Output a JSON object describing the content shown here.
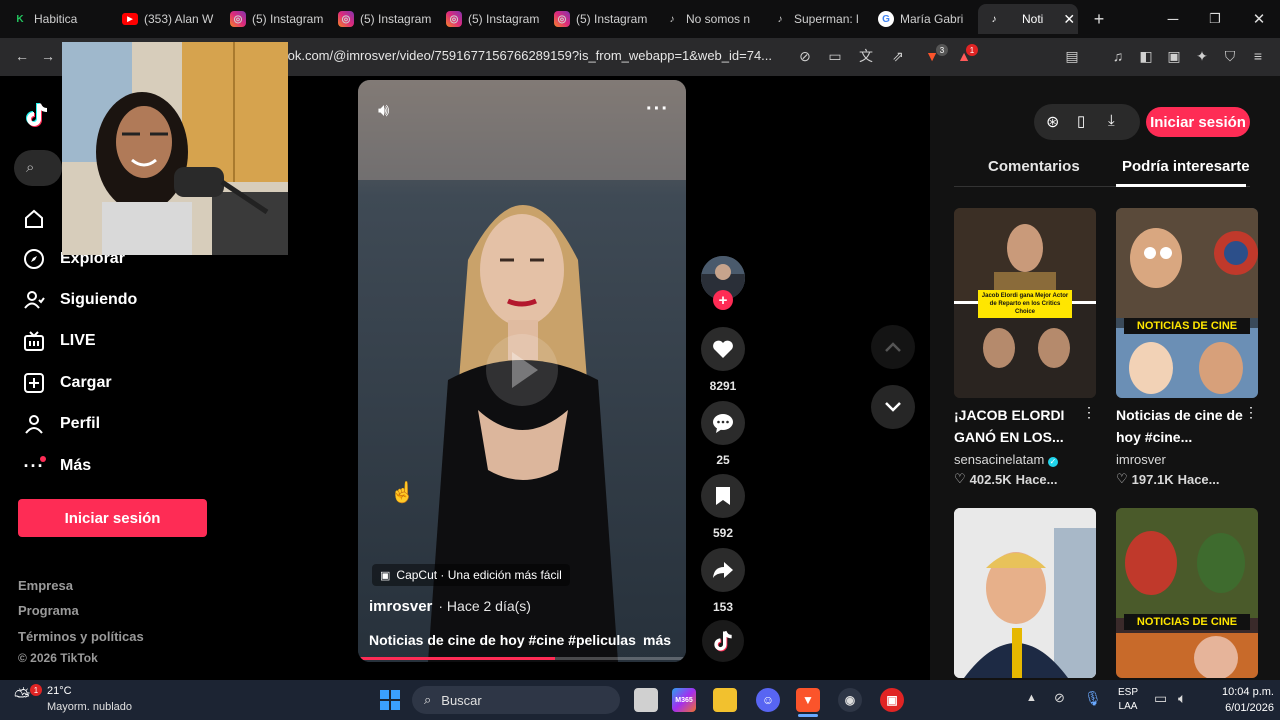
{
  "browser": {
    "tabs": [
      {
        "title": "Habitica",
        "icon": "habitica-icon",
        "color": "#22c55e"
      },
      {
        "title": "(353) Alan W",
        "icon": "youtube-icon",
        "color": "#ff0000"
      },
      {
        "title": "(5) Instagram",
        "icon": "instagram-icon",
        "color": "#e1306c"
      },
      {
        "title": "(5) Instagram",
        "icon": "instagram-icon",
        "color": "#e1306c"
      },
      {
        "title": "(5) Instagram",
        "icon": "instagram-icon",
        "color": "#e1306c"
      },
      {
        "title": "(5) Instagram",
        "icon": "instagram-icon",
        "color": "#e1306c"
      },
      {
        "title": "No somos n",
        "icon": "tiktok-icon",
        "color": "#ffffff"
      },
      {
        "title": "Superman: l",
        "icon": "tiktok-icon",
        "color": "#ffffff"
      },
      {
        "title": "María Gabri",
        "icon": "google-icon",
        "color": "#4285f4"
      },
      {
        "title": "Noti",
        "icon": "tiktok-icon",
        "color": "#ffffff"
      }
    ],
    "url": "tok.com/@imrosver/video/7591677156766289159?is_from_webapp=1&web_id=74...",
    "extension_badge_1": "3",
    "extension_badge_2": "1"
  },
  "sidebar": {
    "items": [
      {
        "label": "Explorar",
        "icon": "compass-icon"
      },
      {
        "label": "Siguiendo",
        "icon": "following-icon"
      },
      {
        "label": "LIVE",
        "icon": "live-icon"
      },
      {
        "label": "Cargar",
        "icon": "upload-icon"
      },
      {
        "label": "Perfil",
        "icon": "profile-icon"
      },
      {
        "label": "Más",
        "icon": "more-icon"
      }
    ],
    "login_label": "Iniciar sesión",
    "footer": [
      "Empresa",
      "Programa",
      "Términos y políticas",
      "© 2026 TikTok"
    ]
  },
  "video": {
    "capcut_label": "CapCut · Una edición más fácil",
    "author": "imrosver",
    "age": "· Hace 2 día(s)",
    "description": "Noticias de cine de hoy #cine #peliculas ...",
    "more_label": "más",
    "progress": 0.6
  },
  "actions": {
    "likes": "8291",
    "comments": "25",
    "saves": "592",
    "shares": "153"
  },
  "right_panel": {
    "login_label": "Iniciar sesión",
    "tabs": [
      "Comentarios",
      "Podría interesarte"
    ],
    "active_tab": "Podría interesarte",
    "cards": [
      {
        "title": "¡JACOB ELORDI GANÓ EN LOS...",
        "author": "sensacinelatam",
        "verified": true,
        "likes": "402.5K",
        "age": "Hace...",
        "thumb_text": "Jacob Elordi gana Mejor Actor de Reparto en los Critics Choice"
      },
      {
        "title": "Noticias de cine de hoy #cine...",
        "author": "imrosver",
        "verified": false,
        "likes": "197.1K",
        "age": "Hace...",
        "thumb_text": "NOTICIAS DE CINE"
      },
      {
        "thumb_text": ""
      },
      {
        "thumb_text": "NOTICIAS DE CINE"
      }
    ]
  },
  "taskbar": {
    "weather_temp": "21°C",
    "weather_desc": "Mayorm. nublado",
    "search_label": "Buscar",
    "lang_1": "ESP",
    "lang_2": "LAA",
    "time": "10:04 p.m.",
    "date": "6/01/2026",
    "weather_badge": "1"
  }
}
